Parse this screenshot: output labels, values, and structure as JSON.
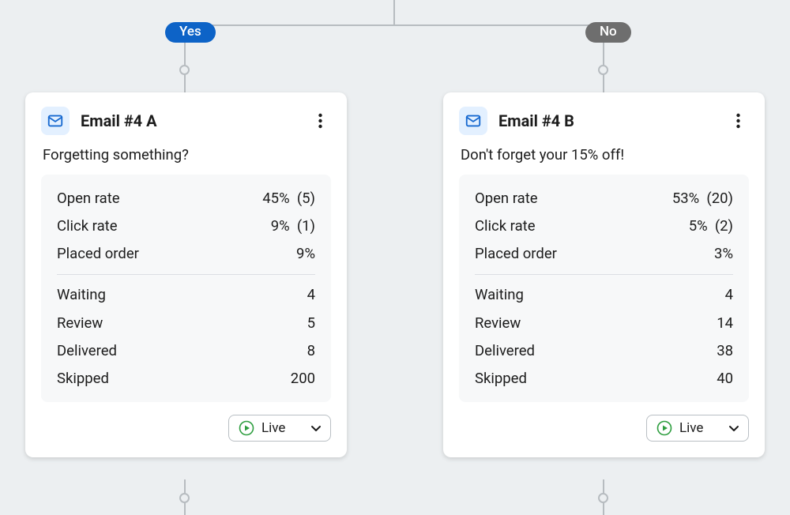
{
  "branches": {
    "yes": "Yes",
    "no": "No"
  },
  "labels": {
    "open_rate": "Open rate",
    "click_rate": "Click rate",
    "placed_order": "Placed order",
    "waiting": "Waiting",
    "review": "Review",
    "delivered": "Delivered",
    "skipped": "Skipped",
    "status_live": "Live"
  },
  "cardA": {
    "title": "Email #4 A",
    "subject": "Forgetting something?",
    "open_rate_pct": "45%",
    "open_rate_count": "(5)",
    "click_rate_pct": "9%",
    "click_rate_count": "(1)",
    "placed_order_pct": "9%",
    "waiting": "4",
    "review": "5",
    "delivered": "8",
    "skipped": "200"
  },
  "cardB": {
    "title": "Email #4 B",
    "subject": "Don't forget your 15% off!",
    "open_rate_pct": "53%",
    "open_rate_count": "(20)",
    "click_rate_pct": "5%",
    "click_rate_count": "(2)",
    "placed_order_pct": "3%",
    "waiting": "4",
    "review": "14",
    "delivered": "38",
    "skipped": "40"
  }
}
